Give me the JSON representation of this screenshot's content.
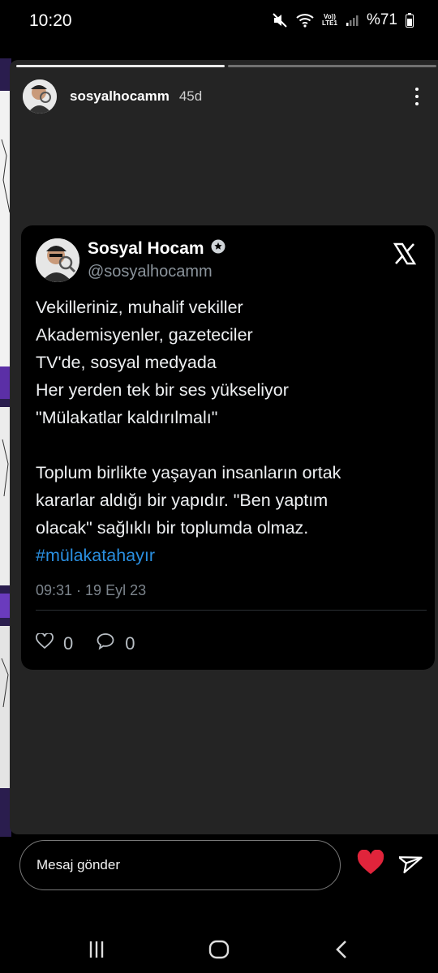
{
  "status_bar": {
    "time": "10:20",
    "network_label_top": "Vo))",
    "network_label_bottom": "LTE1",
    "battery": "%71",
    "icons": [
      "mute-icon",
      "wifi-icon",
      "signal-icon",
      "battery-icon"
    ]
  },
  "story": {
    "username": "sosyalhocamm",
    "age": "45d",
    "progress_segments": 2,
    "progress_done": 1
  },
  "tweet": {
    "name": "Sosyal Hocam",
    "handle": "@sosyalhocamm",
    "lines": [
      "Vekilleriniz, muhalif vekiller",
      "Akademisyenler, gazeteciler",
      "TV'de, sosyal medyada",
      "Her yerden tek bir ses yükseliyor",
      "\"Mülakatlar kaldırılmalı\"",
      "",
      "Toplum birlikte yaşayan insanların ortak",
      "kararlar aldığı bir yapıdır. \"Ben yaptım",
      "olacak\" sağlıklı bir toplumda olmaz."
    ],
    "hashtag": "#mülakatahayır",
    "date": "09:31 · 19 Eyl 23",
    "likes": "0",
    "replies": "0"
  },
  "reply": {
    "placeholder": "Mesaj gönder"
  },
  "colors": {
    "accent_hashtag": "#2a8fe0",
    "heart": "#e0243b",
    "story_bg": "#242424",
    "tweet_bg": "#000000"
  }
}
